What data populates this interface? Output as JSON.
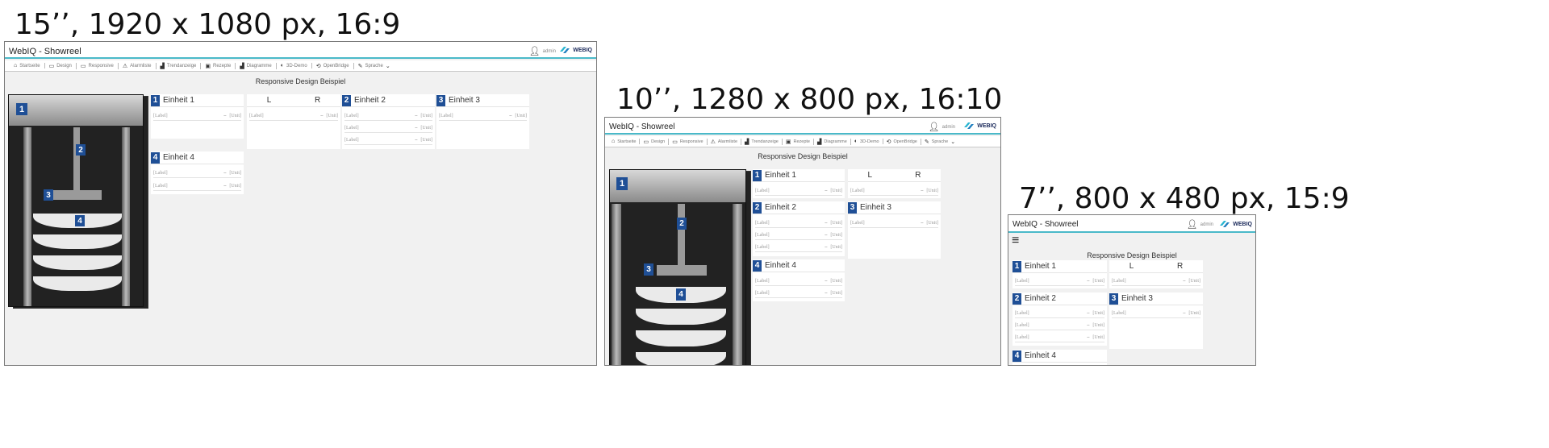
{
  "captions": {
    "screen_15": "15’’, 1920 x 1080 px, 16:9",
    "screen_10": "10’’, 1280 x 800 px, 16:10",
    "screen_7": "7’’, 800 x 480 px, 15:9"
  },
  "app": {
    "title": "WebIQ - Showreel",
    "user": "admin",
    "logo": "WEBIQ",
    "page_title": "Responsive Design Beispiel"
  },
  "nav": [
    {
      "icon": "home-icon",
      "glyph": "⌂",
      "label": "Startseite"
    },
    {
      "icon": "design-icon",
      "glyph": "▭",
      "label": "Design"
    },
    {
      "icon": "responsive-icon",
      "glyph": "▭",
      "label": "Responsive"
    },
    {
      "icon": "alarm-icon",
      "glyph": "⚠",
      "label": "Alarmliste"
    },
    {
      "icon": "trend-icon",
      "glyph": "▟",
      "label": "Trendanzeige"
    },
    {
      "icon": "recipe-icon",
      "glyph": "▣",
      "label": "Rezepte"
    },
    {
      "icon": "chart-icon",
      "glyph": "▟",
      "label": "Diagramme"
    },
    {
      "icon": "cube-icon",
      "glyph": "◐",
      "label": "3D-Demo"
    },
    {
      "icon": "bridge-icon",
      "glyph": "⟲",
      "label": "OpenBridge"
    },
    {
      "icon": "language-icon",
      "glyph": "✎",
      "label": "Sprache"
    }
  ],
  "units": {
    "u1": {
      "number": "1",
      "title": "Einheit 1"
    },
    "u2": {
      "number": "2",
      "title": "Einheit 2"
    },
    "u3": {
      "number": "3",
      "title": "Einheit 3"
    },
    "u4": {
      "number": "4",
      "title": "Einheit 4"
    },
    "lr": {
      "left": "L",
      "right": "R"
    }
  },
  "field": {
    "label": "[Label]",
    "dash": "–",
    "unit": "[Unit]"
  },
  "machine": {
    "markers": [
      "1",
      "2",
      "3",
      "4"
    ]
  }
}
